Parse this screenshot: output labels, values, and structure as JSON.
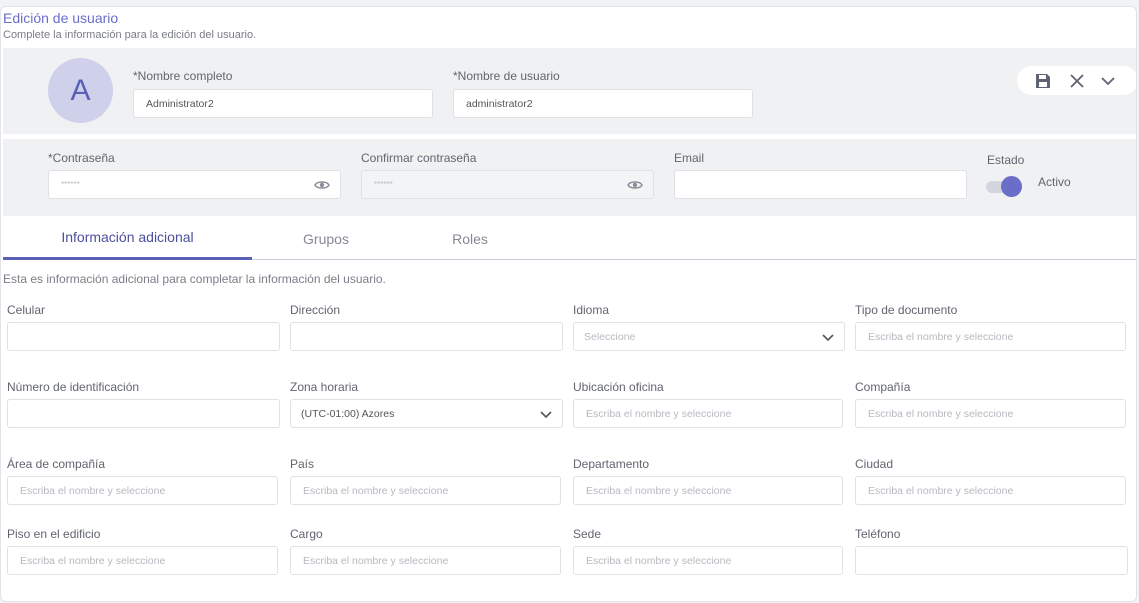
{
  "header": {
    "title": "Edición de usuario",
    "subtitle": "Complete la información para la edición del usuario."
  },
  "profile": {
    "avatar_letter": "A",
    "full_name_label": "*Nombre completo",
    "full_name_value": "Administrator2",
    "username_label": "*Nombre de usuario",
    "username_value": "administrator2"
  },
  "toolbar": {
    "save_icon": "save-icon",
    "close_icon": "close-icon",
    "expand_icon": "chevron-down-icon"
  },
  "credentials": {
    "password_label": "*Contraseña",
    "password_value": "******",
    "confirm_label": "Confirmar contraseña",
    "confirm_value": "******",
    "email_label": "Email",
    "email_value": "",
    "status_label": "Estado",
    "status_value": "Activo",
    "status_on": true,
    "accent_color": "#6a6ec9"
  },
  "tabs": [
    {
      "label": "Información adicional",
      "active": true
    },
    {
      "label": "Grupos",
      "active": false
    },
    {
      "label": "Roles",
      "active": false
    }
  ],
  "info_text": "Esta es información adicional para completar la información del usuario.",
  "fields": {
    "celular": {
      "label": "Celular",
      "value": ""
    },
    "direccion": {
      "label": "Dirección",
      "value": ""
    },
    "idioma": {
      "label": "Idioma",
      "placeholder": "Seleccione"
    },
    "tipo_documento": {
      "label": "Tipo de documento",
      "placeholder": "Escriba el nombre y seleccione"
    },
    "numero_identificacion": {
      "label": "Número de identificación",
      "value": ""
    },
    "zona_horaria": {
      "label": "Zona horaria",
      "value": "(UTC-01:00) Azores"
    },
    "ubicacion_oficina": {
      "label": "Ubicación oficina",
      "placeholder": "Escriba el nombre y seleccione"
    },
    "compania": {
      "label": "Compañía",
      "placeholder": "Escriba el nombre y seleccione"
    },
    "area_compania": {
      "label": "Área de compañía",
      "placeholder": "Escriba el nombre y seleccione"
    },
    "pais": {
      "label": "País",
      "placeholder": "Escriba el nombre y seleccione"
    },
    "departamento": {
      "label": "Departamento",
      "placeholder": "Escriba el nombre y seleccione"
    },
    "ciudad": {
      "label": "Ciudad",
      "placeholder": "Escriba el nombre y seleccione"
    },
    "piso": {
      "label": "Piso en el edificio",
      "placeholder": "Escriba el nombre y seleccione"
    },
    "cargo": {
      "label": "Cargo",
      "placeholder": "Escriba el nombre y seleccione"
    },
    "sede": {
      "label": "Sede",
      "placeholder": "Escriba el nombre y seleccione"
    },
    "telefono": {
      "label": "Teléfono",
      "value": ""
    }
  }
}
